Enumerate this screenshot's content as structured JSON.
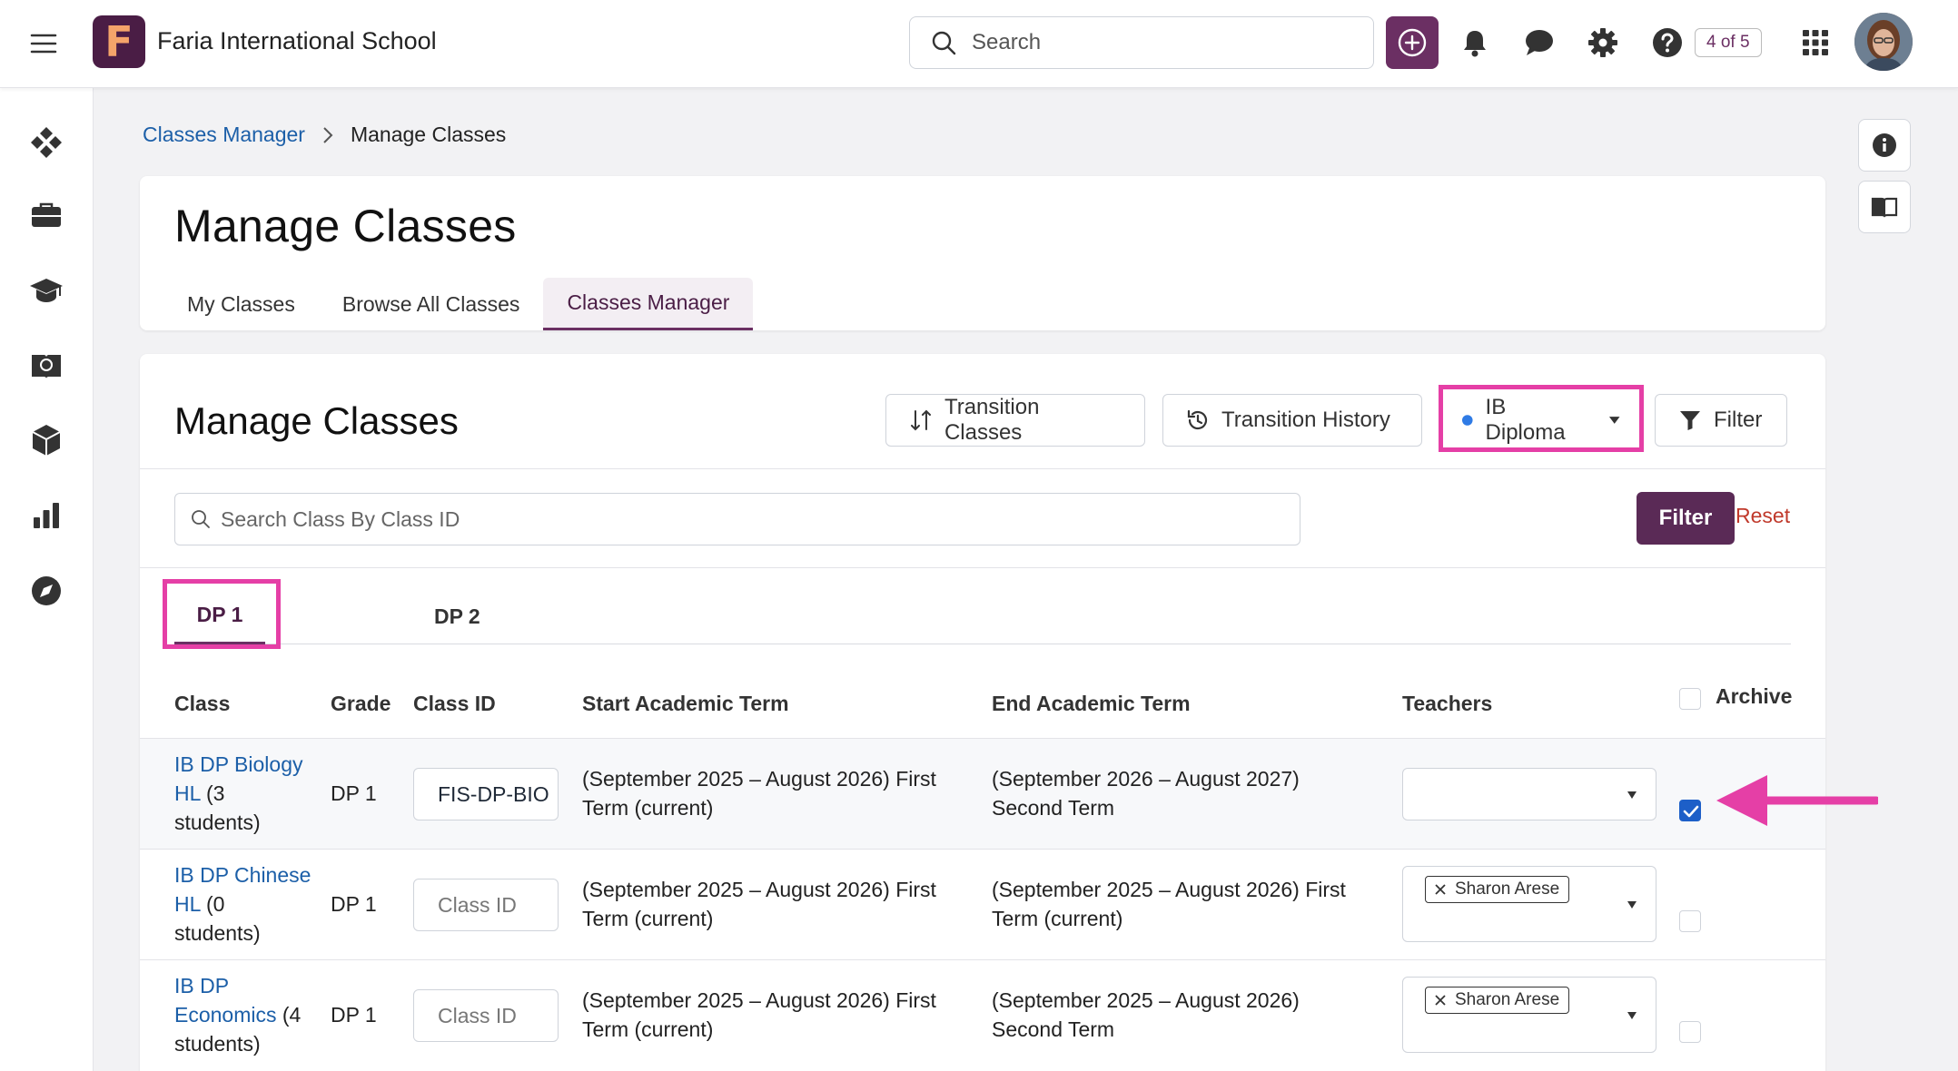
{
  "header": {
    "school_name": "Faria International School",
    "logo_letter": "F",
    "search_placeholder": "Search",
    "counter": "4 of 5"
  },
  "breadcrumb": {
    "parent": "Classes Manager",
    "current": "Manage Classes"
  },
  "page": {
    "title": "Manage Classes",
    "tabs": [
      "My Classes",
      "Browse All Classes",
      "Classes Manager"
    ],
    "active_tab": "Classes Manager"
  },
  "manage": {
    "title": "Manage Classes",
    "transition_classes": "Transition Classes",
    "transition_history": "Transition History",
    "program": "IB Diploma",
    "filter_label": "Filter",
    "search_placeholder": "Search Class By Class ID",
    "filter_button": "Filter",
    "reset": "Reset",
    "grade_tabs": [
      "DP 1",
      "DP 2"
    ],
    "active_grade_tab": "DP 1"
  },
  "table": {
    "headers": {
      "class": "Class",
      "grade": "Grade",
      "class_id": "Class ID",
      "start_term": "Start Academic Term",
      "end_term": "End Academic Term",
      "teachers": "Teachers",
      "archive": "Archive"
    },
    "rows": [
      {
        "class_l1": "IB DP Biology",
        "class_l2_link": "HL",
        "class_l2_rest": " (3",
        "class_l3": "students)",
        "grade": "DP 1",
        "class_id": "FIS-DP-BIO",
        "start_l1": "(September 2025 – August 2026) First",
        "start_l2": "Term (current)",
        "end_l1": "(September 2026 – August 2027)",
        "end_l2": "Second Term",
        "teacher": "",
        "archived": true
      },
      {
        "class_l1": "IB DP Chinese",
        "class_l2_link": "HL",
        "class_l2_rest": " (0",
        "class_l3": "students)",
        "grade": "DP 1",
        "class_id_placeholder": "Class ID",
        "start_l1": "(September 2025 – August 2026) First",
        "start_l2": "Term (current)",
        "end_l1": "(September 2025 – August 2026) First",
        "end_l2": "Term (current)",
        "teacher": "Sharon Arese",
        "archived": false
      },
      {
        "class_l1": "IB DP",
        "class_l2_link": "Economics",
        "class_l2_rest": " (4",
        "class_l3": "students)",
        "grade": "DP 1",
        "class_id_placeholder": "Class ID",
        "start_l1": "(September 2025 – August 2026) First",
        "start_l2": "Term (current)",
        "end_l1": "(September 2025 – August 2026)",
        "end_l2": "Second Term",
        "teacher": "Sharon Arese",
        "archived": false
      }
    ]
  },
  "colors": {
    "brand": "#6b2f63",
    "highlight": "#e53fa6",
    "link": "#1c5fa8",
    "reset": "#c0392b",
    "checkbox": "#1d5fc8"
  }
}
